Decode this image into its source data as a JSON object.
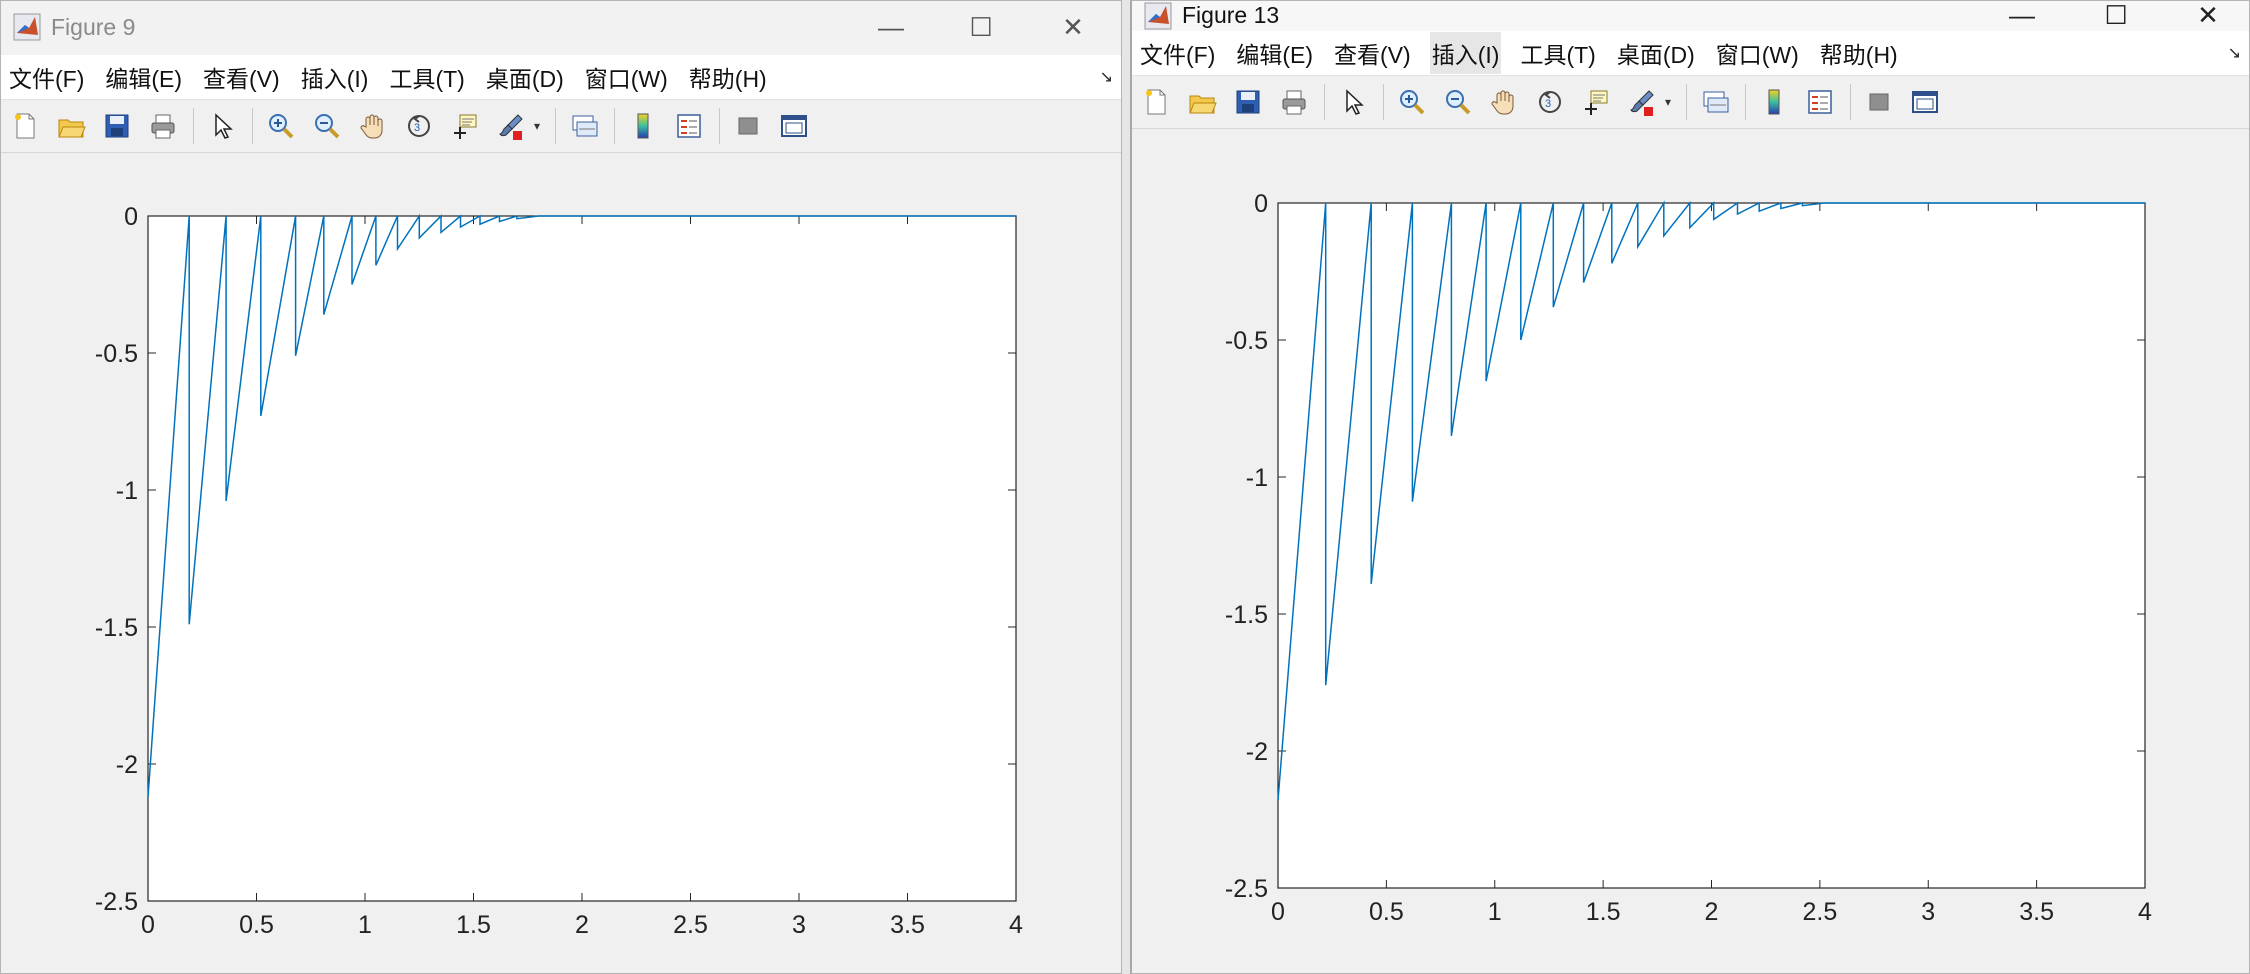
{
  "windows": [
    {
      "title": "Figure 9",
      "menu": [
        "文件(F)",
        "编辑(E)",
        "查看(V)",
        "插入(I)",
        "工具(T)",
        "桌面(D)",
        "窗口(W)",
        "帮助(H)"
      ],
      "toolbar": [
        "new-figure-icon",
        "open-file-icon",
        "save-icon",
        "print-icon",
        "pointer-icon",
        "zoom-in-icon",
        "zoom-out-icon",
        "pan-hand-icon",
        "rotate-3d-icon",
        "data-cursor-icon",
        "brush-icon",
        "link-plot-icon",
        "colorbar-icon",
        "legend-icon",
        "hide-plot-tools-icon",
        "show-plot-tools-icon"
      ],
      "chart_data": {
        "type": "line",
        "title": "",
        "xlabel": "",
        "ylabel": "",
        "xlim": [
          0,
          4
        ],
        "ylim": [
          -2.5,
          0
        ],
        "xticks": [
          "0",
          "0.5",
          "1",
          "1.5",
          "2",
          "2.5",
          "3",
          "3.5",
          "4"
        ],
        "yticks": [
          "0",
          "-0.5",
          "-1",
          "-1.5",
          "-2",
          "-2.5"
        ],
        "grid": false,
        "line_color": "#0072bd",
        "series": [
          {
            "x": [
              0,
              0.19,
              0.19,
              0.36,
              0.36,
              0.52,
              0.52,
              0.68,
              0.68,
              0.81,
              0.81,
              0.94,
              0.94,
              1.05,
              1.05,
              1.15,
              1.15,
              1.25,
              1.25,
              1.35,
              1.35,
              1.44,
              1.44,
              1.53,
              1.53,
              1.62,
              1.62,
              1.7,
              1.7,
              1.8,
              2.0,
              4.0
            ],
            "y": [
              -2.12,
              0,
              -1.49,
              0,
              -1.04,
              0,
              -0.73,
              0,
              -0.51,
              0,
              -0.36,
              0,
              -0.25,
              0,
              -0.18,
              0,
              -0.12,
              0,
              -0.08,
              0,
              -0.06,
              0,
              -0.04,
              0,
              -0.03,
              0,
              -0.02,
              0,
              -0.01,
              0,
              0,
              0
            ]
          }
        ]
      }
    },
    {
      "title": "Figure 13",
      "menu": [
        "文件(F)",
        "编辑(E)",
        "查看(V)",
        "插入(I)",
        "工具(T)",
        "桌面(D)",
        "窗口(W)",
        "帮助(H)"
      ],
      "toolbar": [
        "new-figure-icon",
        "open-file-icon",
        "save-icon",
        "print-icon",
        "pointer-icon",
        "zoom-in-icon",
        "zoom-out-icon",
        "pan-hand-icon",
        "rotate-3d-icon",
        "data-cursor-icon",
        "brush-icon",
        "link-plot-icon",
        "colorbar-icon",
        "legend-icon",
        "hide-plot-tools-icon",
        "show-plot-tools-icon"
      ],
      "chart_data": {
        "type": "line",
        "title": "",
        "xlabel": "",
        "ylabel": "",
        "xlim": [
          0,
          4
        ],
        "ylim": [
          -2.5,
          0
        ],
        "xticks": [
          "0",
          "0.5",
          "1",
          "1.5",
          "2",
          "2.5",
          "3",
          "3.5",
          "4"
        ],
        "yticks": [
          "0",
          "-0.5",
          "-1",
          "-1.5",
          "-2",
          "-2.5"
        ],
        "grid": false,
        "line_color": "#0072bd",
        "series": [
          {
            "x": [
              0,
              0.22,
              0.22,
              0.43,
              0.43,
              0.62,
              0.62,
              0.8,
              0.8,
              0.96,
              0.96,
              1.12,
              1.12,
              1.27,
              1.27,
              1.41,
              1.41,
              1.54,
              1.54,
              1.66,
              1.66,
              1.78,
              1.78,
              1.9,
              1.9,
              2.01,
              2.01,
              2.12,
              2.12,
              2.22,
              2.22,
              2.32,
              2.32,
              2.42,
              2.42,
              2.52,
              2.7,
              4.0
            ],
            "y": [
              -2.18,
              0,
              -1.76,
              0,
              -1.39,
              0,
              -1.09,
              0,
              -0.85,
              0,
              -0.65,
              0,
              -0.5,
              0,
              -0.38,
              0,
              -0.29,
              0,
              -0.22,
              0,
              -0.16,
              0,
              -0.12,
              0,
              -0.09,
              0,
              -0.06,
              0,
              -0.04,
              0,
              -0.03,
              0,
              -0.02,
              0,
              -0.01,
              0,
              0,
              0
            ]
          }
        ]
      }
    }
  ]
}
